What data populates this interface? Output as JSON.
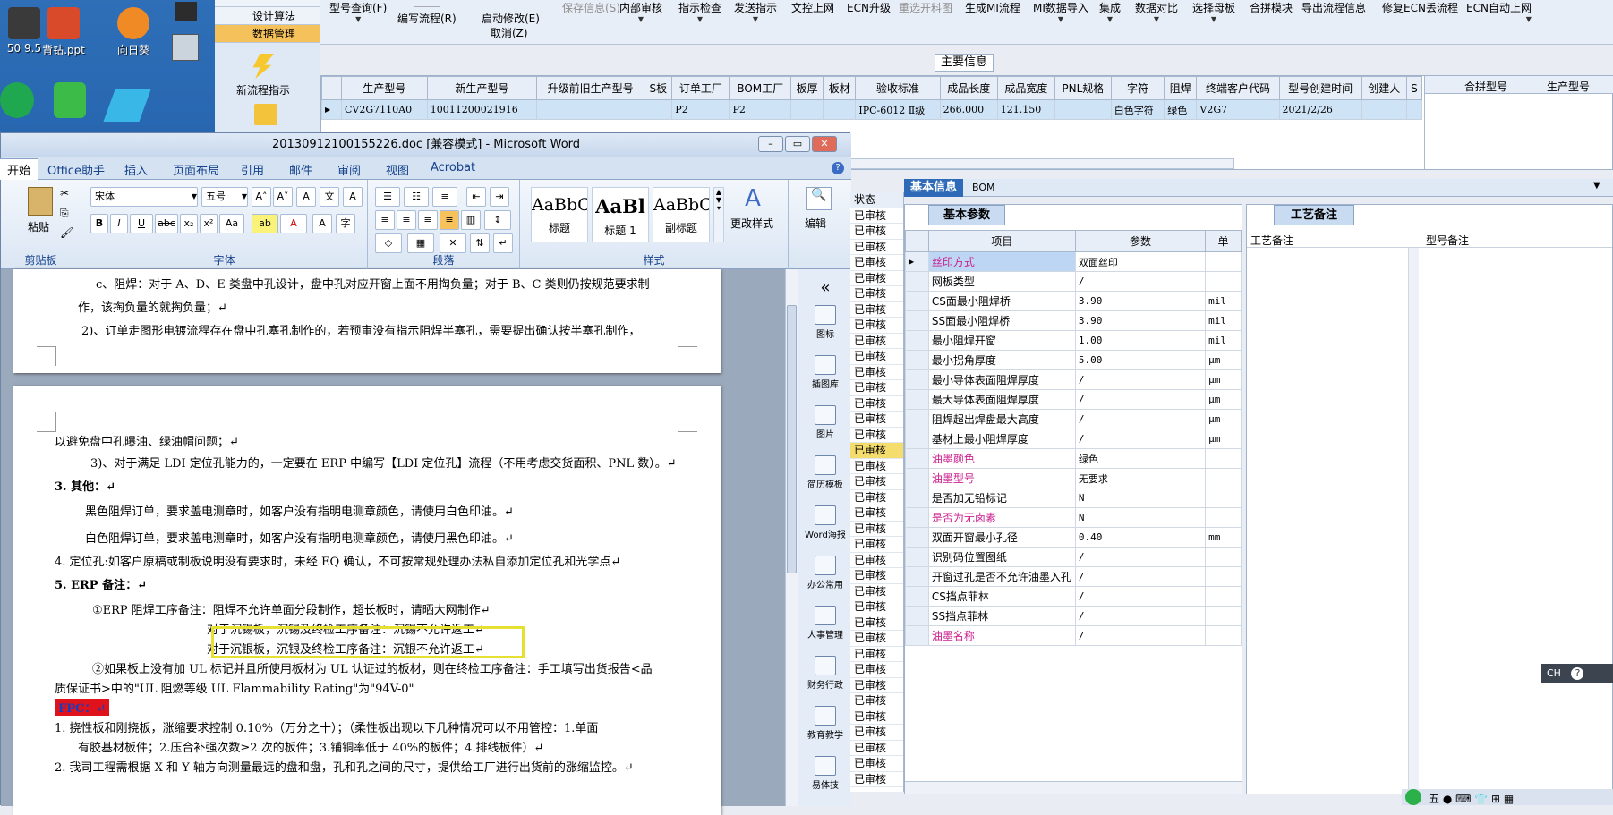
{
  "desktop": {
    "icons": [
      {
        "label": "50 9.5"
      },
      {
        "label": "背钻.ppt"
      },
      {
        "label": "向日葵"
      }
    ]
  },
  "nav": {
    "items": [
      {
        "label": "设计算法"
      },
      {
        "label": "数据管理"
      }
    ],
    "new_flow": "新流程指示"
  },
  "toolbar": {
    "items": [
      {
        "label": "型号查询(F)"
      },
      {
        "label": "编写流程(R)"
      },
      {
        "label": "启动修改(E)"
      },
      {
        "label": "保存信息(S)"
      },
      {
        "label": "内部审核"
      },
      {
        "label": "指示检查"
      },
      {
        "label": "发送指示"
      },
      {
        "label": "文控上网"
      },
      {
        "label": "ECN升级"
      },
      {
        "label": "重选开料图"
      },
      {
        "label": "生成MI流程"
      },
      {
        "label": "MI数据导入"
      },
      {
        "label": "集成"
      },
      {
        "label": "数据对比"
      },
      {
        "label": "选择母板"
      },
      {
        "label": "合拼模块"
      },
      {
        "label": "导出流程信息"
      },
      {
        "label": "修复ECN丢流程"
      },
      {
        "label": "ECN自动上网"
      }
    ],
    "cancel": "取消(Z)"
  },
  "main_info": {
    "title": "主要信息",
    "columns": [
      "生产型号",
      "新生产型号",
      "升级前旧生产型号",
      "S板",
      "订单工厂",
      "BOM工厂",
      "板厚",
      "板材",
      "验收标准",
      "成品长度",
      "成品宽度",
      "PNL规格",
      "字符",
      "阻焊",
      "终端客户代码",
      "型号创建时间",
      "创建人",
      "S"
    ],
    "row": [
      "CV2G7110A0",
      "10011200021916",
      "",
      "",
      "P2",
      "P2",
      "",
      "",
      "IPC-6012 Ⅱ级",
      "266.000",
      "121.150",
      "",
      "白色字符",
      "绿色",
      "V2G7",
      "2021/2/26",
      "",
      ""
    ],
    "merge_columns": [
      "合拼型号",
      "生产型号"
    ]
  },
  "word": {
    "title": "20130912100155226.doc [兼容模式] - Microsoft Word",
    "tabs": [
      "开始",
      "Office助手",
      "插入",
      "页面布局",
      "引用",
      "邮件",
      "审阅",
      "视图",
      "Acrobat"
    ],
    "font_name": "宋体",
    "font_size": "五号",
    "groups": {
      "clipboard": "剪贴板",
      "font": "字体",
      "paragraph": "段落",
      "styles": "样式",
      "paste": "粘贴",
      "edit": "编辑",
      "change_styles": "更改样式"
    },
    "styles": [
      {
        "preview": "AaBbC",
        "name": "标题"
      },
      {
        "preview": "AaBl",
        "name": "标题 1"
      },
      {
        "preview": "AaBbC",
        "name": "副标题"
      }
    ],
    "page1": [
      "c、阻焊：对于 A、D、E 类盘中孔设计，盘中孔对应开窗上面不用掏负量；对于 B、C 类则仍按规范要求制",
      "作，该掏负量的就掏负量；↵",
      "2)、订单走图形电镀流程存在盘中孔塞孔制作的，若预审没有指示阻焊半塞孔，需要提出确认按半塞孔制作，"
    ],
    "page2": [
      "以避免盘中孔曝油、绿油帽问题；↵",
      "3)、对于满足 LDI 定位孔能力的，一定要在 ERP 中编写【LDI 定位孔】流程（不用考虑交货面积、PNL 数）。↵",
      "3. 其他：↵",
      "黑色阻焊订单，要求盖电测章时，如客户没有指明电测章颜色，请使用白色印油。↵",
      "白色阻焊订单，要求盖电测章时，如客户没有指明电测章颜色，请使用黑色印油。↵",
      "4. 定位孔:如客户原稿或制板说明没有要求时，未经 EQ 确认，不可按常规处理办法私自添加定位孔和光学点↵",
      "5. ERP 备注：↵",
      "①ERP 阻焊工序备注：阻焊不允许单面分段制作，超长板时，请晒大网制作↵",
      "对于沉锡板，沉锡及终检工序备注：沉锡不允许返工↵",
      "对于沉银板，沉银及终检工序备注：沉银不允许返工↵",
      "②如果板上没有加 UL 标记并且所使用板材为 UL 认证过的板材，则在终检工序备注：手工填写出货报告<品",
      "质保证书>中的\"UL 阻燃等级 UL Flammability Rating\"为\"94V-0\"",
      "FPC：↵",
      "1.  挠性板和刚挠板，涨缩要求控制 0.10%（万分之十）；（柔性板出现以下几种情况可以不用管控：1.单面",
      "有胶基材板件；2.压合补强次数≥2 次的板件；3.铺铜率低于 40%的板件；4.排线板件）↵",
      "2.  我司工程需根据 X 和 Y 轴方向测量最远的盘和盘，孔和孔之间的尺寸，提供给工厂进行出货前的涨缩监控。↵"
    ],
    "side_pane": [
      "图标",
      "插图库",
      "图片",
      "简历模板",
      "Word海报",
      "办公常用",
      "人事管理",
      "财务行政",
      "教育教学",
      "易体技"
    ]
  },
  "detail": {
    "header_tab": "基本信息",
    "header_tab2": "BOM",
    "status_label": "状态",
    "status_value": "已审核",
    "params_tab": "基本参数",
    "remark_tab": "工艺备注",
    "params_columns": [
      "项目",
      "参数",
      "单"
    ],
    "params": [
      {
        "name": "丝印方式",
        "value": "双面丝印",
        "unit": "",
        "pink": true
      },
      {
        "name": "网板类型",
        "value": "/",
        "unit": "",
        "pink": false
      },
      {
        "name": "CS面最小阻焊桥",
        "value": "3.90",
        "unit": "mil",
        "pink": false
      },
      {
        "name": "SS面最小阻焊桥",
        "value": "3.90",
        "unit": "mil",
        "pink": false
      },
      {
        "name": "最小阻焊开窗",
        "value": "1.00",
        "unit": "mil",
        "pink": false
      },
      {
        "name": "最小拐角厚度",
        "value": "5.00",
        "unit": "μm",
        "pink": false
      },
      {
        "name": "最小导体表面阻焊厚度",
        "value": "/",
        "unit": "μm",
        "pink": false
      },
      {
        "name": "最大导体表面阻焊厚度",
        "value": "/",
        "unit": "μm",
        "pink": false
      },
      {
        "name": "阻焊超出焊盘最大高度",
        "value": "/",
        "unit": "μm",
        "pink": false
      },
      {
        "name": "基材上最小阻焊厚度",
        "value": "/",
        "unit": "μm",
        "pink": false
      },
      {
        "name": "油墨颜色",
        "value": "绿色",
        "unit": "",
        "pink": true
      },
      {
        "name": "油墨型号",
        "value": "无要求",
        "unit": "",
        "pink": true
      },
      {
        "name": "是否加无铅标记",
        "value": "N",
        "unit": "",
        "pink": false
      },
      {
        "name": "是否为无卤素",
        "value": "N",
        "unit": "",
        "pink": true
      },
      {
        "name": "双面开窗最小孔径",
        "value": "0.40",
        "unit": "mm",
        "pink": false
      },
      {
        "name": "识别码位置图纸",
        "value": "/",
        "unit": "",
        "pink": false
      },
      {
        "name": "开窗过孔是否不允许油墨入孔",
        "value": "/",
        "unit": "",
        "pink": false
      },
      {
        "name": "CS挡点菲林",
        "value": "/",
        "unit": "",
        "pink": false
      },
      {
        "name": "SS挡点菲林",
        "value": "/",
        "unit": "",
        "pink": false
      },
      {
        "name": "油墨名称",
        "value": "/",
        "unit": "",
        "pink": true
      }
    ],
    "remark_columns": [
      "工艺备注",
      "型号备注"
    ]
  },
  "ime": {
    "label": "CH"
  }
}
